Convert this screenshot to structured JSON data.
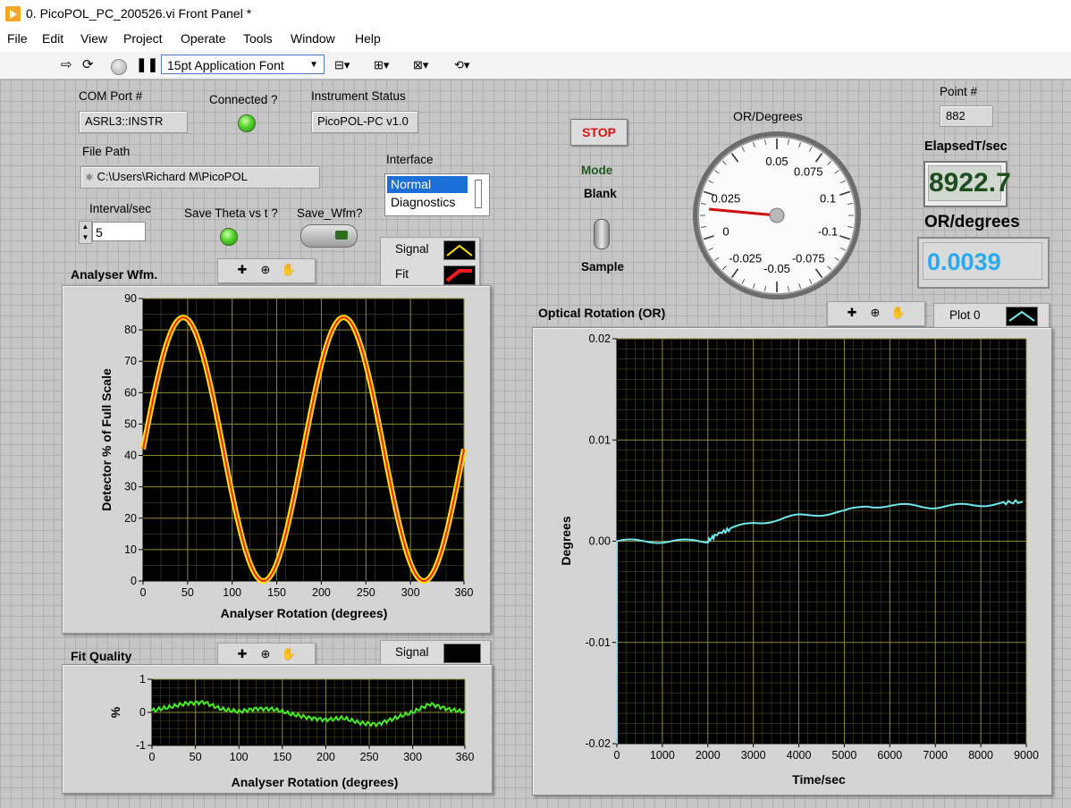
{
  "window": {
    "title": "0. PicoPOL_PC_200526.vi Front Panel *"
  },
  "menu": [
    "File",
    "Edit",
    "View",
    "Project",
    "Operate",
    "Tools",
    "Window",
    "Help"
  ],
  "toolbar": {
    "font": "15pt Application Font"
  },
  "com_port": {
    "label": "COM Port #",
    "value": "ASRL3::INSTR"
  },
  "connected": {
    "label": "Connected ?"
  },
  "instrument_status": {
    "label": "Instrument Status",
    "value": "PicoPOL-PC v1.0"
  },
  "file_path": {
    "label": "File Path",
    "value": "C:\\Users\\Richard M\\PicoPOL"
  },
  "interface": {
    "label": "Interface",
    "options": [
      "Normal",
      "Diagnostics"
    ],
    "selected": "Normal"
  },
  "interval": {
    "label": "Interval/sec",
    "value": "5"
  },
  "save_theta": {
    "label": "Save Theta vs t ?"
  },
  "save_wfm": {
    "label": "Save_Wfm?"
  },
  "stop_button": {
    "label": "STOP"
  },
  "mode": {
    "label": "Mode",
    "top": "Blank",
    "bottom": "Sample"
  },
  "gauge": {
    "label": "OR/Degrees",
    "value": 0.0039,
    "scale": [
      {
        "v": "0.05",
        "angle": 0
      },
      {
        "v": "0.075",
        "angle": 36
      },
      {
        "v": "0.1",
        "angle": 72
      },
      {
        "v": "-0.1",
        "angle": 108
      },
      {
        "v": "-0.075",
        "angle": 144
      },
      {
        "v": "-0.05",
        "angle": 180
      },
      {
        "v": "-0.025",
        "angle": 216
      },
      {
        "v": "0",
        "angle": 252
      },
      {
        "v": "0.025",
        "angle": 288
      }
    ]
  },
  "point": {
    "label": "Point #",
    "value": "882"
  },
  "elapsed": {
    "label": "ElapsedT/sec",
    "value": "8922.7"
  },
  "or_degrees": {
    "label": "OR/degrees",
    "value": "0.0039"
  },
  "analyser_chart": {
    "title": "Analyser Wfm.",
    "legend": [
      {
        "name": "Signal",
        "color": "#ffe600"
      },
      {
        "name": "Fit",
        "color": "#ff1a1a"
      }
    ]
  },
  "fit_chart": {
    "title": "Fit Quality",
    "legend": [
      {
        "name": "Signal",
        "color": "#000000"
      }
    ]
  },
  "or_chart": {
    "title": "Optical Rotation (OR)",
    "legend": [
      {
        "name": "Plot 0",
        "color": "#6fe9ef"
      }
    ]
  },
  "chart_data": [
    {
      "type": "line",
      "title": "Analyser Wfm.",
      "xlabel": "Analyser Rotation (degrees)",
      "ylabel": "Detector % of Full Scale",
      "xlim": [
        0,
        360
      ],
      "ylim": [
        0,
        90
      ],
      "xticks": [
        0,
        50,
        100,
        150,
        200,
        250,
        300,
        360
      ],
      "yticks": [
        0,
        10,
        20,
        30,
        40,
        50,
        60,
        70,
        80,
        90
      ],
      "grid": true,
      "series": [
        {
          "name": "Signal",
          "color": "#ffe600",
          "model": "42 + 42*sin(2*pi*x/180)"
        },
        {
          "name": "Fit",
          "color": "#ff1a1a",
          "model": "42 + 42*sin(2*pi*x/180)"
        }
      ]
    },
    {
      "type": "line",
      "title": "Fit Quality",
      "xlabel": "Analyser Rotation (degrees)",
      "ylabel": "%",
      "xlim": [
        0,
        360
      ],
      "ylim": [
        -1,
        1
      ],
      "xticks": [
        0,
        50,
        100,
        150,
        200,
        250,
        300,
        360
      ],
      "yticks": [
        -1,
        0,
        1
      ],
      "grid": true,
      "series": [
        {
          "name": "Signal",
          "color": "#44ee22",
          "x": [
            0,
            20,
            40,
            60,
            80,
            100,
            120,
            140,
            160,
            180,
            200,
            220,
            240,
            260,
            280,
            300,
            320,
            340,
            360
          ],
          "y": [
            0.0,
            0.12,
            0.28,
            0.35,
            0.15,
            0.05,
            0.1,
            0.05,
            -0.1,
            -0.18,
            -0.2,
            -0.12,
            -0.28,
            -0.35,
            -0.2,
            -0.05,
            0.22,
            0.1,
            0.05
          ]
        }
      ]
    },
    {
      "type": "line",
      "title": "Optical Rotation (OR)",
      "xlabel": "Time/sec",
      "ylabel": "Degrees",
      "xlim": [
        0,
        9000
      ],
      "ylim": [
        -0.02,
        0.02
      ],
      "xticks": [
        0,
        1000,
        2000,
        3000,
        4000,
        5000,
        6000,
        7000,
        8000,
        9000
      ],
      "yticks": [
        -0.02,
        -0.01,
        0.0,
        0.01,
        0.02
      ],
      "grid": true,
      "series": [
        {
          "name": "Plot 0",
          "color": "#6fe9ef",
          "x": [
            0,
            500,
            1000,
            1500,
            2000,
            2200,
            2500,
            3000,
            3500,
            4000,
            4500,
            5000,
            5500,
            6000,
            6500,
            7000,
            7500,
            8000,
            8500,
            8922
          ],
          "y": [
            0.0,
            0.0,
            0.0,
            0.0,
            0.0,
            0.0007,
            0.0012,
            0.0018,
            0.0021,
            0.0025,
            0.0027,
            0.0029,
            0.0035,
            0.0035,
            0.0035,
            0.0034,
            0.0035,
            0.0036,
            0.0038,
            0.0039
          ]
        }
      ]
    }
  ]
}
